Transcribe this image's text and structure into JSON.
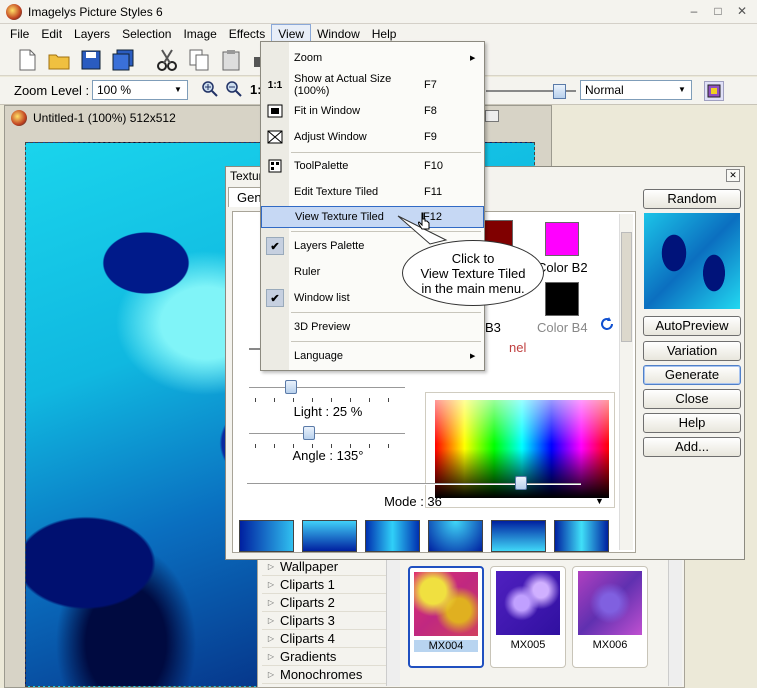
{
  "window": {
    "title": "Imagelys Picture Styles 6"
  },
  "menubar": [
    "File",
    "Edit",
    "Layers",
    "Selection",
    "Image",
    "Effects",
    "View",
    "Window",
    "Help"
  ],
  "toolbar2": {
    "zoom_label": "Zoom Level :",
    "zoom_value": "100 %",
    "actual_label": "1:",
    "blend_mode": "Normal"
  },
  "document": {
    "title": "Untitled-1 (100%) 512x512"
  },
  "view_menu": {
    "items": [
      {
        "label": "Zoom",
        "shortcut": "",
        "icon": "",
        "submenu": true
      },
      {
        "label": "Show at Actual Size (100%)",
        "shortcut": "F7",
        "icon": "1:1"
      },
      {
        "label": "Fit in Window",
        "shortcut": "F8",
        "icon": "fit-window-icon"
      },
      {
        "label": "Adjust Window",
        "shortcut": "F9",
        "icon": "adjust-window-icon"
      },
      {
        "label": "ToolPalette",
        "shortcut": "F10",
        "icon": "tool-palette-icon"
      },
      {
        "label": "Edit Texture Tiled",
        "shortcut": "F11",
        "icon": ""
      },
      {
        "label": "View Texture Tiled",
        "shortcut": "F12",
        "icon": "",
        "highlighted": true
      },
      {
        "label": "Layers Palette",
        "shortcut": "",
        "checked": true
      },
      {
        "label": "Ruler",
        "shortcut": ""
      },
      {
        "label": "Window list",
        "shortcut": "",
        "checked": true
      },
      {
        "label": "3D Preview",
        "shortcut": ""
      },
      {
        "label": "Language",
        "shortcut": "",
        "submenu": true
      }
    ]
  },
  "callout": {
    "line1": "Click to",
    "line2": "View Texture Tiled",
    "line3": "in the main menu."
  },
  "texture_dialog": {
    "title": "Texture",
    "tab": "Gen",
    "buttons": [
      "Random",
      "AutoPreview",
      "Variation",
      "Generate",
      "Close",
      "Help",
      "Add..."
    ],
    "colors": {
      "b2_label": "Color B2",
      "b3_label": "r B3",
      "b4_label": "Color B4",
      "b1_color": "#800000",
      "b2_color": "#ff00ff",
      "b4_color": "#000000"
    },
    "panel_label": "nel",
    "light_label": "Light : 25 %",
    "angle_label": "Angle : 135°",
    "mode_label": "Mode : 36",
    "light_value": 25,
    "angle_value": 135,
    "mode_value": 36
  },
  "categories": [
    "Wallpaper",
    "Cliparts 1",
    "Cliparts 2",
    "Cliparts 3",
    "Cliparts 4",
    "Gradients",
    "Monochromes"
  ],
  "thumbnails": [
    {
      "label": "MX004",
      "selected": true
    },
    {
      "label": "MX005"
    },
    {
      "label": "MX006"
    }
  ]
}
